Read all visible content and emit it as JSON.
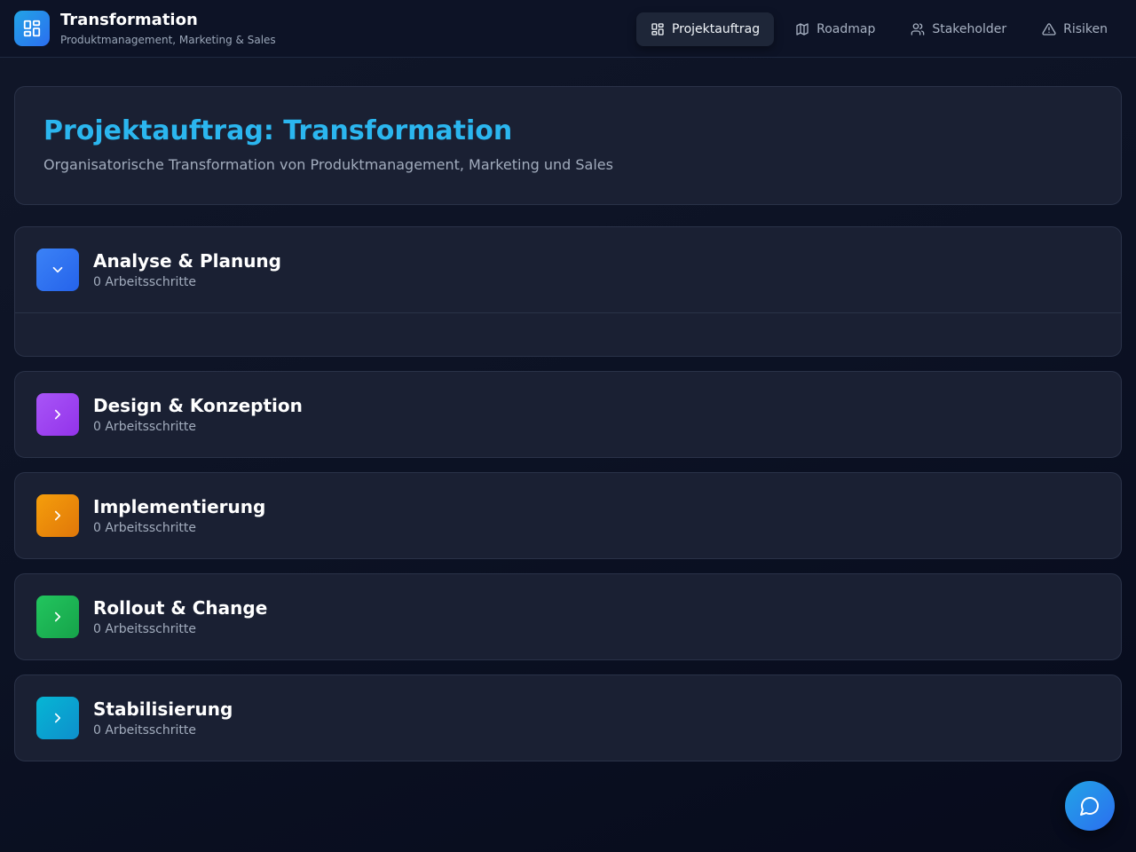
{
  "header": {
    "title": "Transformation",
    "subtitle": "Produktmanagement, Marketing & Sales",
    "logo_icon": "layout-grid-icon",
    "nav": [
      {
        "label": "Projektauftrag",
        "icon": "layout-grid-icon",
        "active": true
      },
      {
        "label": "Roadmap",
        "icon": "map-icon",
        "active": false
      },
      {
        "label": "Stakeholder",
        "icon": "users-icon",
        "active": false
      },
      {
        "label": "Risiken",
        "icon": "alert-triangle-icon",
        "active": false
      }
    ]
  },
  "hero": {
    "title": "Projektauftrag: Transformation",
    "subtitle": "Organisatorische Transformation von Produktmanagement, Marketing und Sales"
  },
  "phases": [
    {
      "title": "Analyse & Planung",
      "count": "0 Arbeitsschritte",
      "color": "#2563eb",
      "expanded": true,
      "icon": "chevron-down-icon"
    },
    {
      "title": "Design & Konzeption",
      "count": "0 Arbeitsschritte",
      "color": "#9333ea",
      "expanded": false,
      "icon": "chevron-right-icon"
    },
    {
      "title": "Implementierung",
      "count": "0 Arbeitsschritte",
      "color": "#ea8a0c",
      "expanded": false,
      "icon": "chevron-right-icon"
    },
    {
      "title": "Rollout & Change",
      "count": "0 Arbeitsschritte",
      "color": "#16a34a",
      "expanded": false,
      "icon": "chevron-right-icon"
    },
    {
      "title": "Stabilisierung",
      "count": "0 Arbeitsschritte",
      "color": "#0e9fcc",
      "expanded": false,
      "icon": "chevron-right-icon"
    }
  ],
  "colors": {
    "accent": "#2bb6ef",
    "background": "#0c1224",
    "card": "#1a2033"
  },
  "chat_button": {
    "icon": "message-circle-icon"
  }
}
